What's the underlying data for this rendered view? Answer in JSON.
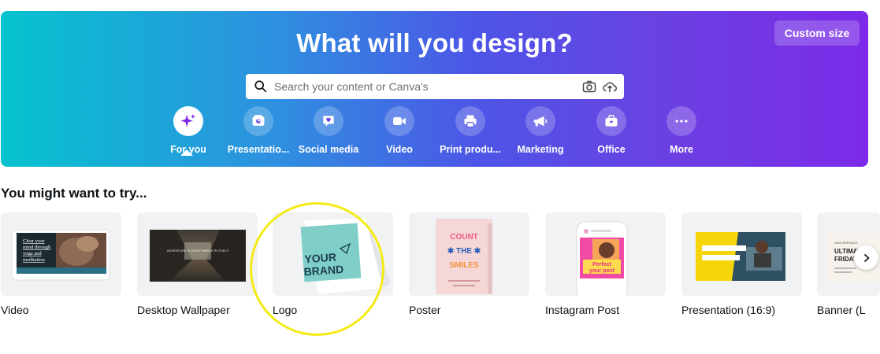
{
  "hero": {
    "title": "What will you design?",
    "custom_size_label": "Custom size",
    "search_placeholder": "Search your content or Canva's",
    "gradient": [
      "#05c3cf",
      "#4d55e6",
      "#7c2ae8"
    ]
  },
  "categories": [
    {
      "label": "For you",
      "icon": "sparkle-icon",
      "active": true
    },
    {
      "label": "Presentatio...",
      "icon": "presentation-icon",
      "active": false
    },
    {
      "label": "Social media",
      "icon": "heart-chat-icon",
      "active": false
    },
    {
      "label": "Video",
      "icon": "video-camera-icon",
      "active": false
    },
    {
      "label": "Print produ...",
      "icon": "printer-icon",
      "active": false
    },
    {
      "label": "Marketing",
      "icon": "megaphone-icon",
      "active": false
    },
    {
      "label": "Office",
      "icon": "briefcase-icon",
      "active": false
    },
    {
      "label": "More",
      "icon": "more-dots-icon",
      "active": false
    }
  ],
  "suggestions": {
    "title": "You might want to try...",
    "items": [
      {
        "label": "Video",
        "thumb_text": "Clear your mind through yoga and meditation"
      },
      {
        "label": "Desktop Wallpaper",
        "thumb_text": "Adventure is worthwhile in itself"
      },
      {
        "label": "Logo",
        "thumb_text": "YOUR BRAND"
      },
      {
        "label": "Poster",
        "thumb_text": "COUNT THE SMILES"
      },
      {
        "label": "Instagram Post",
        "thumb_text": "Perfect your post"
      },
      {
        "label": "Presentation (16:9)",
        "thumb_text": ""
      },
      {
        "label": "Banner (L",
        "thumb_text": "ULTIMATE FRIDAY"
      }
    ]
  },
  "colors": {
    "highlight_circle": "#f3ea16",
    "logo_teal": "#7fcfc8",
    "presentation_yellow": "#f6d60a"
  }
}
